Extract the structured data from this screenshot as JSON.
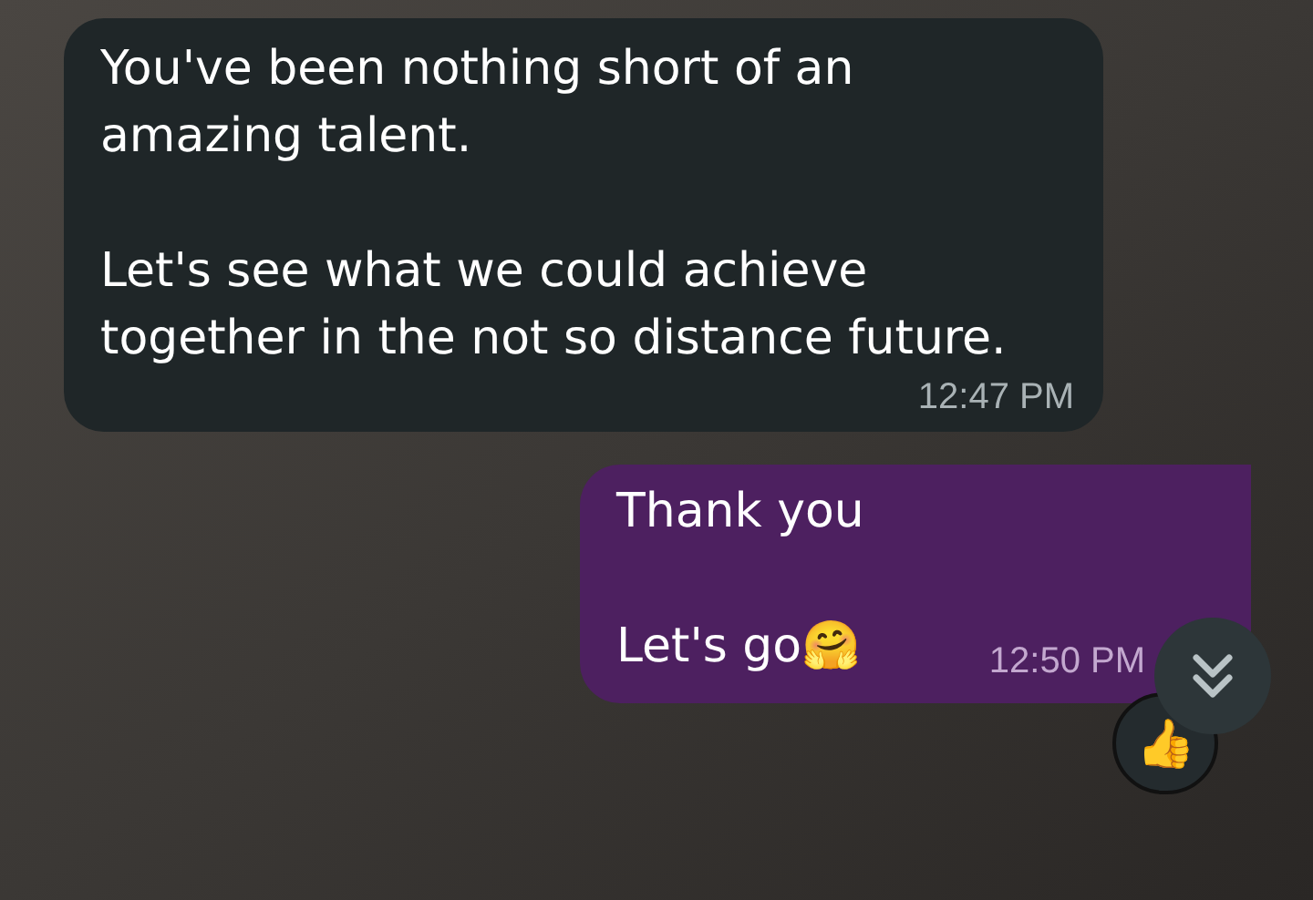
{
  "messages": [
    {
      "kind": "incoming",
      "paragraphs": [
        "You've been nothing short of an amazing talent.",
        "Let's see what we could achieve together in the not so distance future."
      ],
      "time": "12:47 PM"
    },
    {
      "kind": "outgoing",
      "paragraphs": [
        "Thank you",
        "Let's go🤗"
      ],
      "time": "12:50 PM",
      "reaction": "👍"
    }
  ]
}
